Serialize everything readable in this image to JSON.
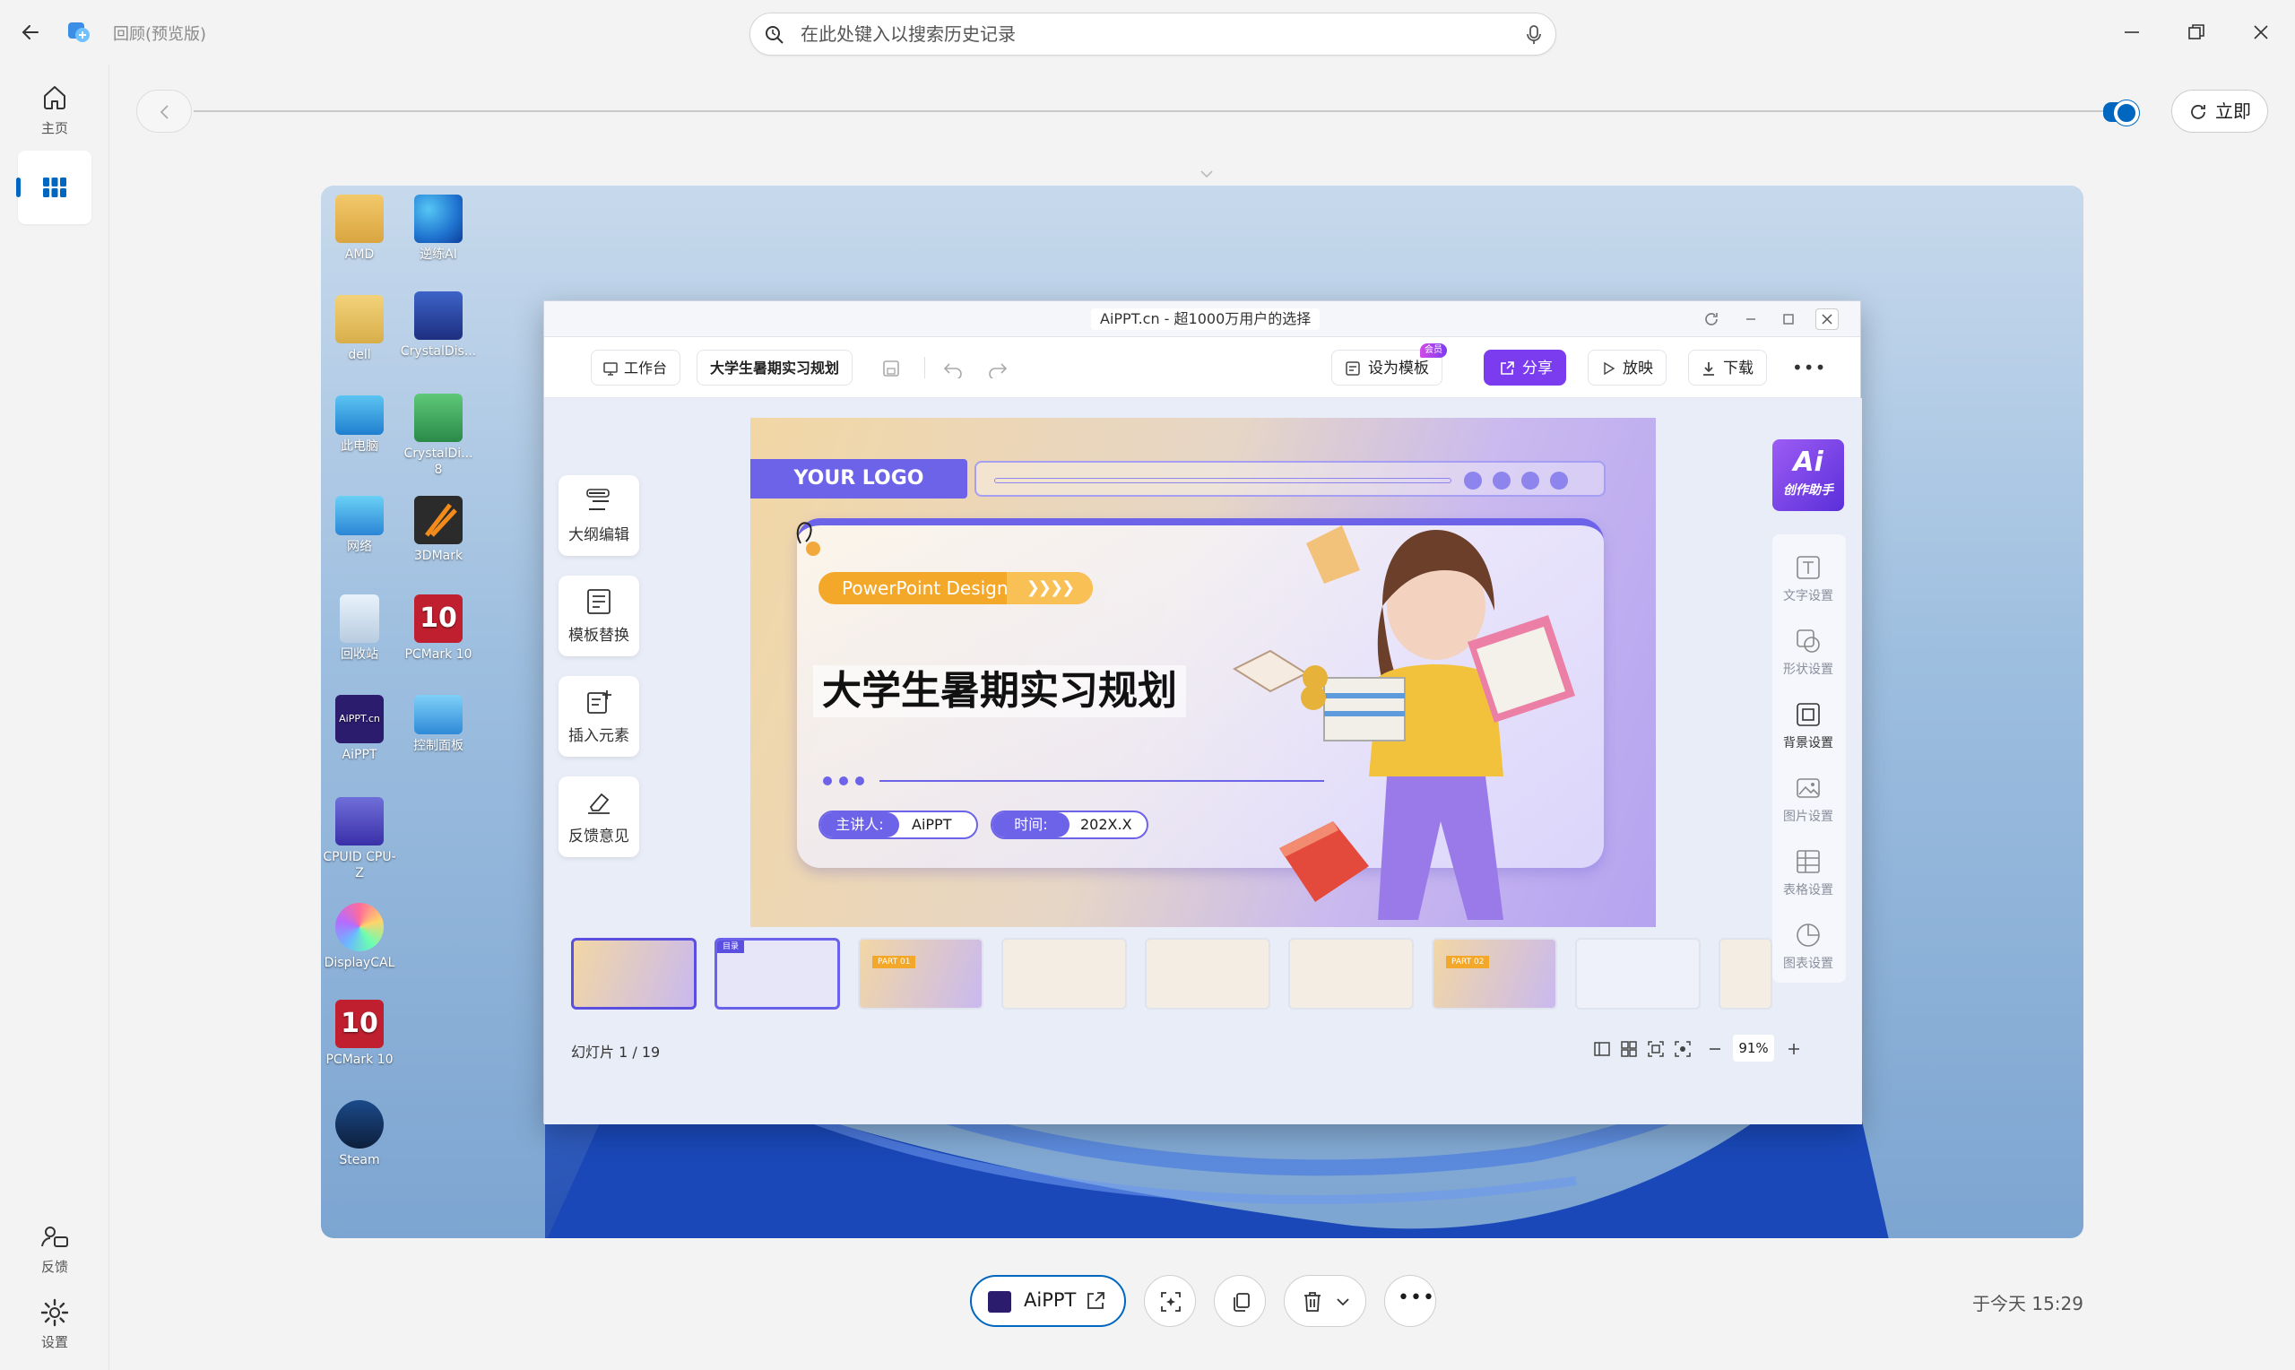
{
  "app": {
    "title": "回顾(预览版)"
  },
  "search": {
    "placeholder": "在此处键入以搜索历史记录"
  },
  "rail": {
    "home_label": "主页",
    "feedback_label": "反馈",
    "settings_label": "设置"
  },
  "timeline": {
    "refresh_label": "立即"
  },
  "desktop": {
    "icons_col1": [
      "AMD",
      "dell",
      "此电脑",
      "网络",
      "回收站",
      "AiPPT",
      "CPUID CPU-Z",
      "DisplayCAL",
      "PCMark 10",
      "Steam"
    ],
    "icons_col2": [
      "逆练AI",
      "CrystalDis...",
      "CrystalDi... 8",
      "3DMark",
      "PCMark 10",
      "控制面板"
    ]
  },
  "aippt": {
    "window_title": "AiPPT.cn - 超1000万用户的选择",
    "workbench": "工作台",
    "doc_title": "大学生暑期实习规划",
    "set_template": "设为模板",
    "set_template_badge": "会员",
    "share": "分享",
    "play": "放映",
    "download": "下载",
    "left_tools": [
      "大纲编辑",
      "模板替换",
      "插入元素",
      "反馈意见"
    ],
    "right_tools": [
      "文字设置",
      "形状设置",
      "背景设置",
      "图片设置",
      "表格设置",
      "图表设置"
    ],
    "ai_badge_top": "Ai",
    "ai_badge_bottom": "创作助手",
    "slide": {
      "logo": "YOUR LOGO",
      "tag": "PowerPoint Design",
      "title": "大学生暑期实习规划",
      "presenter_label": "主讲人:",
      "presenter": "AiPPT",
      "time_label": "时间:",
      "time": "202X.X"
    },
    "thumbnail_tags": [
      "",
      "目录",
      "PART 01",
      "",
      "",
      "",
      "PART 02",
      "",
      ""
    ],
    "slide_counter": "幻灯片  1 / 19",
    "zoom": "91%"
  },
  "bottom": {
    "app_label": "AiPPT",
    "timestamp": "于今天 15:29"
  },
  "colors": {
    "accent": "#0067c0",
    "aippt_purple": "#7b3cf0",
    "slide_bar": "#6c63e8"
  }
}
